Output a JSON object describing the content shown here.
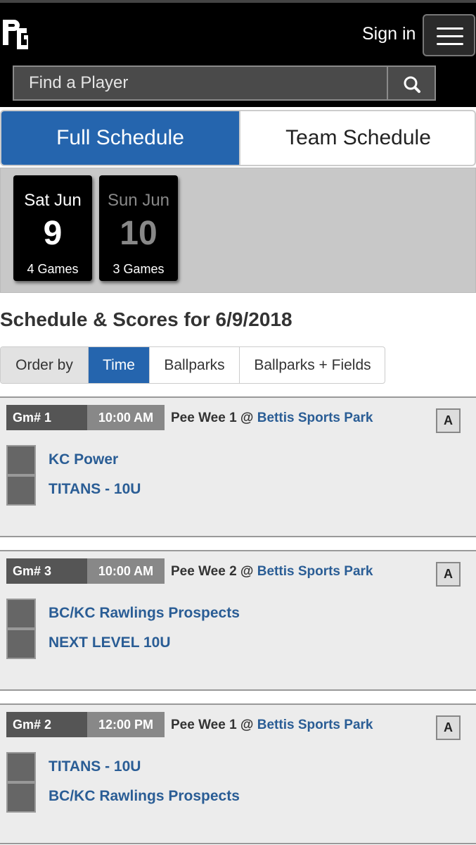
{
  "header": {
    "logo_label": "PG",
    "sign_in": "Sign in"
  },
  "search": {
    "placeholder": "Find a Player"
  },
  "tabs": [
    {
      "label": "Full Schedule",
      "active": true
    },
    {
      "label": "Team Schedule",
      "active": false
    }
  ],
  "dates": [
    {
      "dow": "Sat Jun",
      "day": "9",
      "games": "4 Games",
      "active": true
    },
    {
      "dow": "Sun Jun",
      "day": "10",
      "games": "3 Games",
      "active": false
    }
  ],
  "schedule_title": "Schedule & Scores for 6/9/2018",
  "order_by": {
    "label": "Order by",
    "options": [
      {
        "label": "Time",
        "active": true
      },
      {
        "label": "Ballparks",
        "active": false
      },
      {
        "label": "Ballparks + Fields",
        "active": false
      }
    ]
  },
  "games": [
    {
      "number": "Gm# 1",
      "time": "10:00 AM",
      "field": "Pee Wee 1 @ ",
      "park": "Bettis Sports Park",
      "badge": "A",
      "teams": [
        "KC Power",
        "TITANS - 10U"
      ]
    },
    {
      "number": "Gm# 3",
      "time": "10:00 AM",
      "field": "Pee Wee 2 @ ",
      "park": "Bettis Sports Park",
      "badge": "A",
      "teams": [
        "BC/KC Rawlings Prospects",
        "NEXT LEVEL 10U"
      ]
    },
    {
      "number": "Gm# 2",
      "time": "12:00 PM",
      "field": "Pee Wee 1 @ ",
      "park": "Bettis Sports Park",
      "badge": "A",
      "teams": [
        "TITANS - 10U",
        "BC/KC Rawlings Prospects"
      ]
    }
  ],
  "colors": {
    "accent": "#2565ae",
    "link": "#2a5d95",
    "header_bg": "#000000"
  },
  "icons": {
    "menu": "hamburger-menu-icon",
    "search": "search-icon"
  }
}
